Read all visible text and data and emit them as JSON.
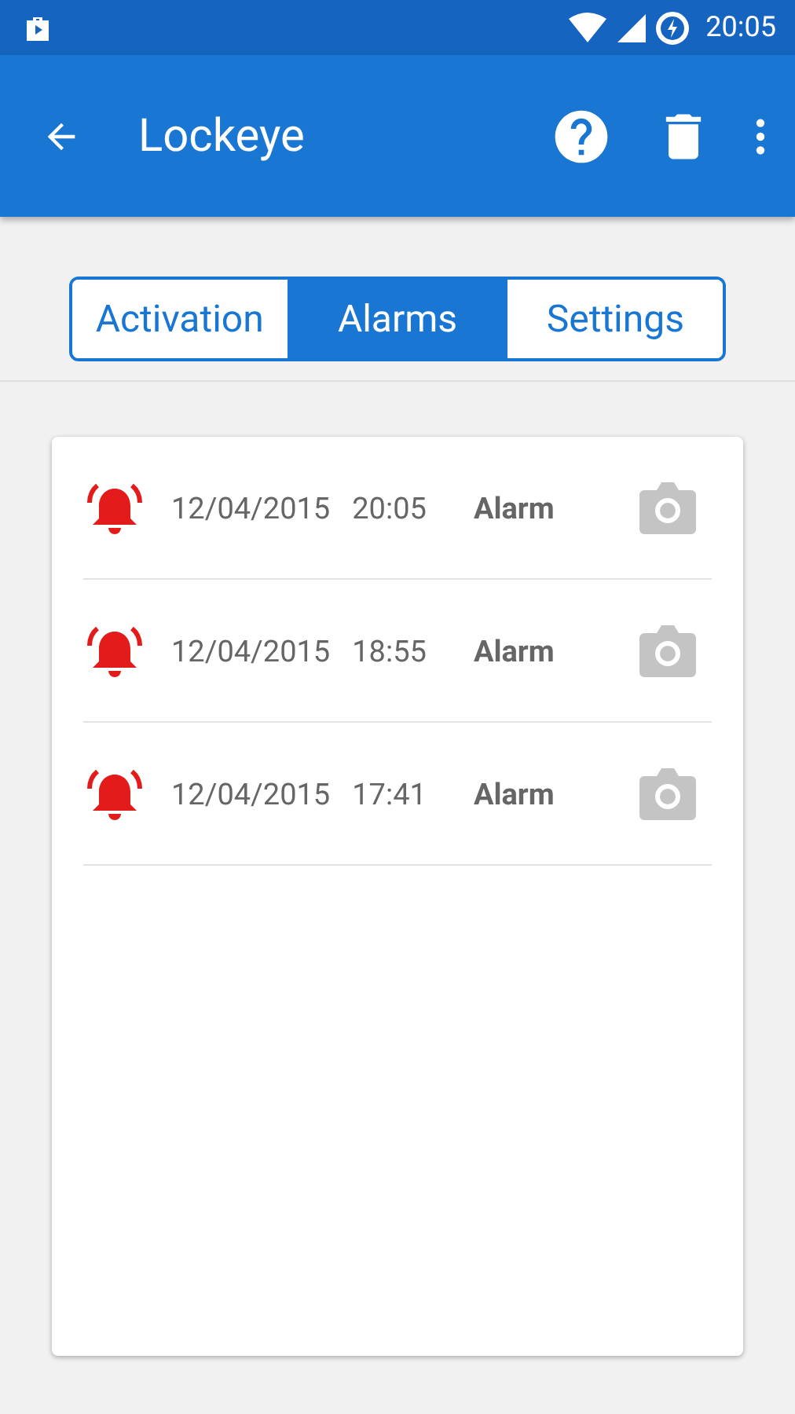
{
  "status_bar": {
    "time": "20:05"
  },
  "app_bar": {
    "title": "Lockeye"
  },
  "tabs": [
    {
      "label": "Activation",
      "selected": false
    },
    {
      "label": "Alarms",
      "selected": true
    },
    {
      "label": "Settings",
      "selected": false
    }
  ],
  "alarms": [
    {
      "date": "12/04/2015",
      "time": "20:05",
      "type": "Alarm"
    },
    {
      "date": "12/04/2015",
      "time": "18:55",
      "type": "Alarm"
    },
    {
      "date": "12/04/2015",
      "time": "17:41",
      "type": "Alarm"
    }
  ]
}
